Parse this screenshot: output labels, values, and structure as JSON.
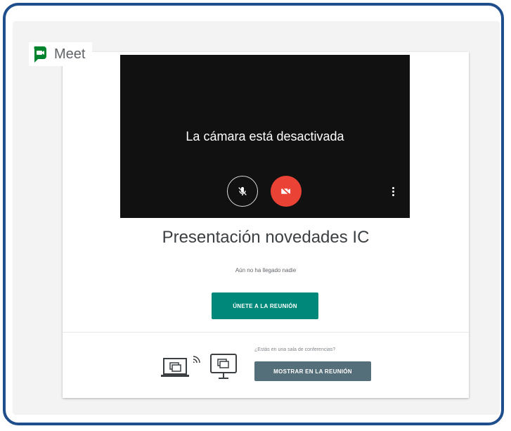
{
  "app": {
    "name": "Meet",
    "logo_icon": "google-meet-icon",
    "brand_colors": {
      "green": "#00832d",
      "blue": "#0066da",
      "yellow": "#ffba00",
      "red": "#e94235"
    }
  },
  "preview": {
    "camera_off_text": "La cámara está desactivada",
    "mic_icon": "mic-off-icon",
    "camera_icon": "camera-off-icon",
    "camera_button_color": "#ea4335",
    "more_icon": "more-vertical-icon"
  },
  "meeting": {
    "title": "Presentación novedades IC",
    "status": "Aún no ha llegado nadie"
  },
  "join": {
    "label": "ÚNETE A LA REUNIÓN",
    "color": "#00897b"
  },
  "room": {
    "question": "¿Estás en una sala de conferencias?",
    "present_label": "MOSTRAR EN LA REUNIÓN",
    "present_color": "#546e7a",
    "laptop_icon": "laptop-icon",
    "cast_icon": "cast-signal-icon",
    "tv_icon": "tv-screen-icon"
  },
  "frame": {
    "border_color": "#1f4e8c"
  }
}
